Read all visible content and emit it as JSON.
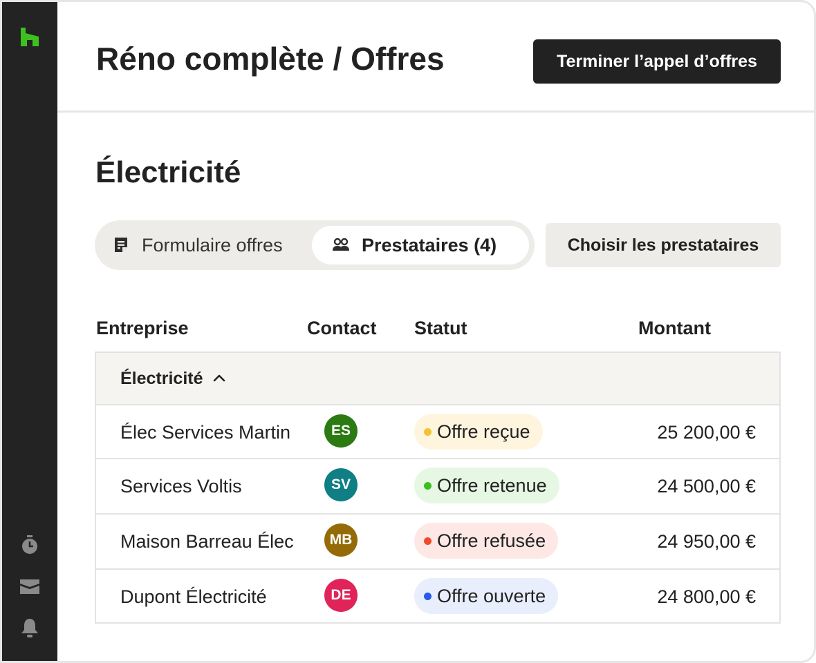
{
  "header": {
    "title_prefix": "Réno complète / ",
    "title_strong": "Offres",
    "finish_button": "Terminer l’appel d’offres"
  },
  "section": {
    "title": "Électricité"
  },
  "tabs": {
    "form": "Formulaire offres",
    "providers": "Prestataires (4)"
  },
  "choose_button": "Choisir les prestataires",
  "table": {
    "columns": [
      "Entreprise",
      "Contact",
      "Statut",
      "Montant"
    ],
    "group_label": "Électricité",
    "rows": [
      {
        "company": "Élec Services Martin",
        "initials": "ES",
        "avatar_color": "#2b7a12",
        "status": "Offre reçue",
        "status_bg": "#fff4de",
        "status_dot": "#f5c12e",
        "amount": "25 200,00 €"
      },
      {
        "company": "Services Voltis",
        "initials": "SV",
        "avatar_color": "#0f7e85",
        "status": "Offre retenue",
        "status_bg": "#e6f8e3",
        "status_dot": "#3cbf1f",
        "amount": "24 500,00 €"
      },
      {
        "company": "Maison Barreau Élec",
        "initials": "MB",
        "avatar_color": "#946b06",
        "status": "Offre refusée",
        "status_bg": "#fde8e6",
        "status_dot": "#f04a2a",
        "amount": "24 950,00 €"
      },
      {
        "company": "Dupont Électricité",
        "initials": "DE",
        "avatar_color": "#e0245a",
        "status": "Offre ouverte",
        "status_bg": "#e8eefc",
        "status_dot": "#2a5be8",
        "amount": "24 800,00 €"
      }
    ]
  },
  "colors": {
    "sidebar": "#232323",
    "brand_green": "#3dc11f",
    "primary_button": "#222222",
    "neutral_button": "#eeece8"
  },
  "icons": {
    "logo": "houzz-logo-icon",
    "timer": "stopwatch-icon",
    "inbox": "inbox-icon",
    "bell": "bell-icon",
    "form": "document-icon",
    "people": "people-icon",
    "chevron": "chevron-up-icon"
  }
}
